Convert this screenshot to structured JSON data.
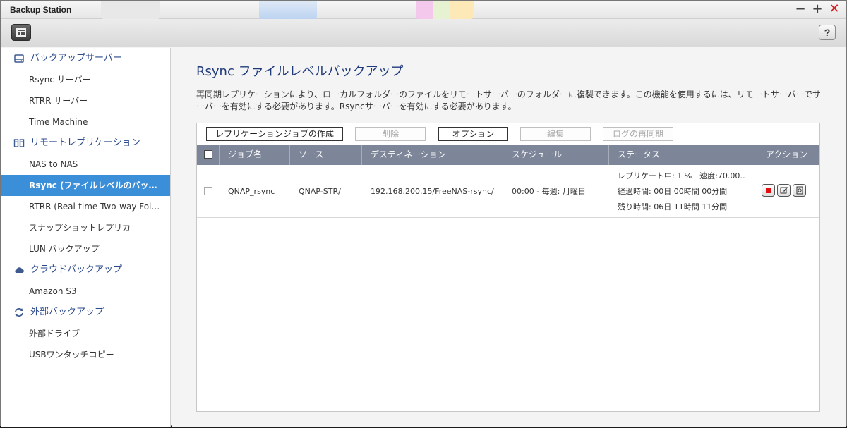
{
  "window": {
    "title": "Backup Station"
  },
  "sidebar": {
    "groups": [
      {
        "label": "バックアップサーバー",
        "icon": "drive-icon",
        "items": [
          "Rsync サーバー",
          "RTRR サーバー",
          "Time Machine"
        ]
      },
      {
        "label": "リモートレプリケーション",
        "icon": "replication-icon",
        "items": [
          "NAS to NAS",
          "Rsync (ファイルレベルのバック…",
          "RTRR (Real-time Two-way Folder …",
          "スナップショットレプリカ",
          "LUN バックアップ"
        ]
      },
      {
        "label": "クラウドバックアップ",
        "icon": "cloud-icon",
        "items": [
          "Amazon S3"
        ]
      },
      {
        "label": "外部バックアップ",
        "icon": "sync-icon",
        "items": [
          "外部ドライブ",
          "USBワンタッチコピー"
        ]
      }
    ],
    "active_item": "Rsync (ファイルレベルのバック…"
  },
  "main": {
    "title": "Rsync ファイルレベルバックアップ",
    "description": "再同期レプリケーションにより、ローカルフォルダーのファイルをリモートサーバーのフォルダーに複製できます。この機能を使用するには、リモートサーバーでサーバーを有効にする必要があります。Rsyncサーバーを有効にする必要があります。",
    "buttons": {
      "create": "レプリケーションジョブの作成",
      "delete": "削除",
      "options": "オプション",
      "edit": "編集",
      "resync_log": "ログの再同期"
    },
    "table": {
      "columns": [
        "ジョブ名",
        "ソース",
        "デスティネーション",
        "スケジュール",
        "ステータス",
        "アクション"
      ],
      "rows": [
        {
          "job_name": "QNAP_rsync",
          "source": "QNAP-STR/",
          "destination": "192.168.200.15/FreeNAS-rsync/",
          "schedule": "00:00 - 毎週: 月曜日",
          "status": [
            "レプリケート中: 1 %　速度:70.00…",
            "経過時間: 00日 00時間 00分間",
            "残り時間: 06日 11時間 11分間"
          ]
        }
      ]
    }
  },
  "colors": {
    "accent": "#3b8fd9",
    "header": "#7d8599",
    "title": "#1f3a7a",
    "stop": "#e01010"
  }
}
